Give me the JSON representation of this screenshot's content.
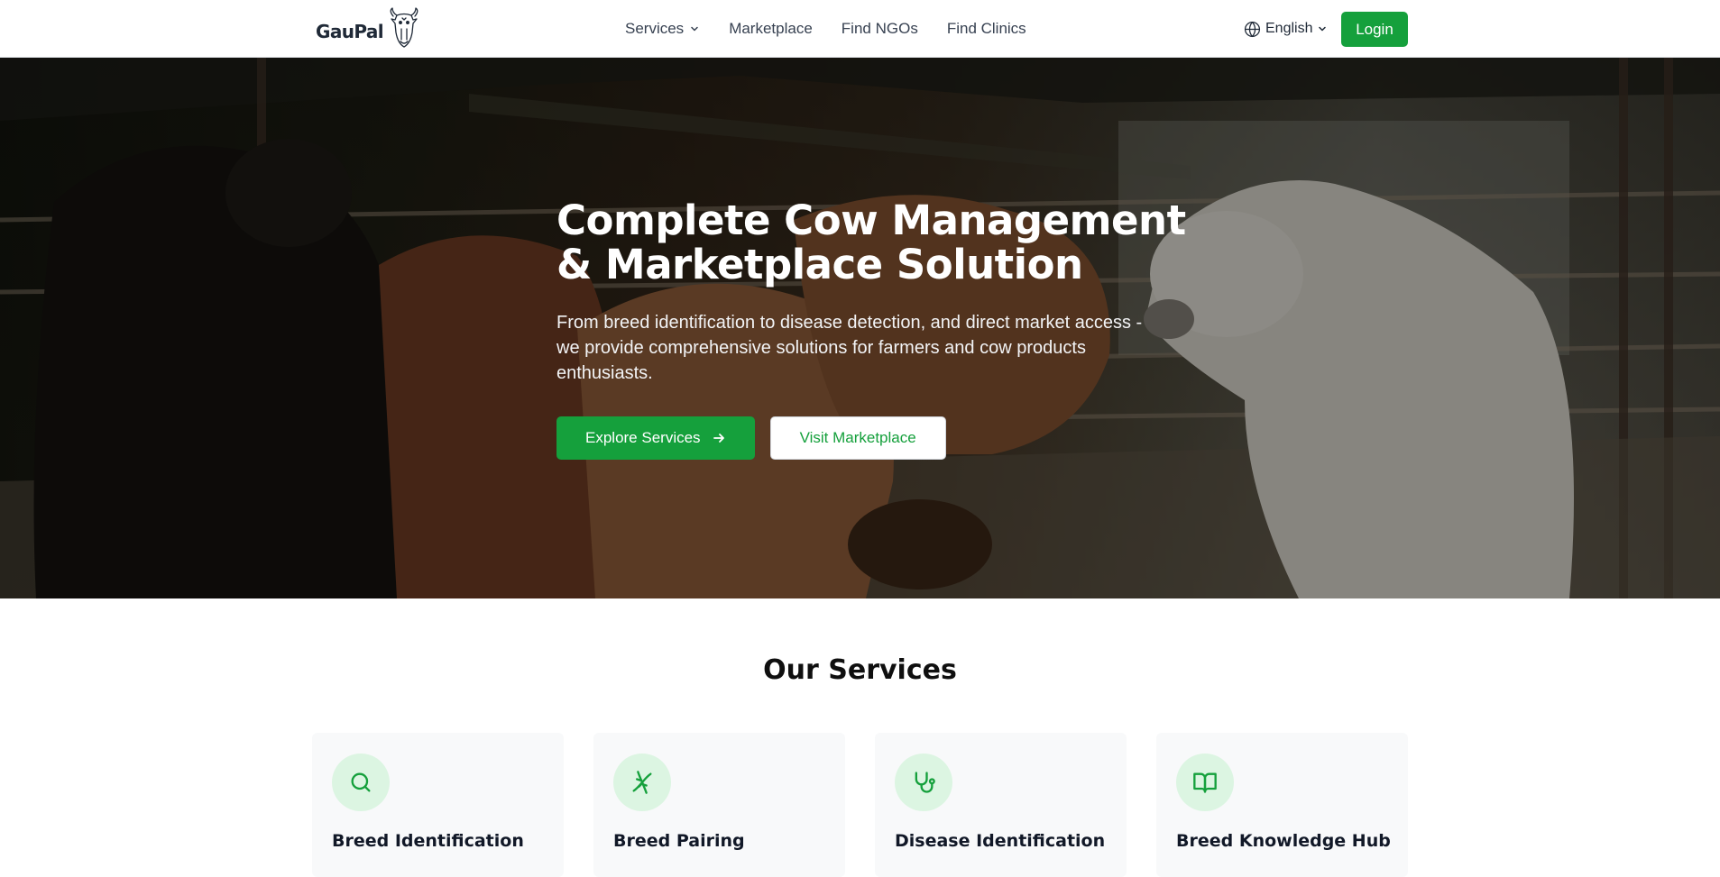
{
  "header": {
    "logo_text": "GauPal",
    "nav": [
      {
        "label": "Services",
        "has_dropdown": true
      },
      {
        "label": "Marketplace"
      },
      {
        "label": "Find NGOs"
      },
      {
        "label": "Find Clinics"
      }
    ],
    "language": "English",
    "login_label": "Login"
  },
  "hero": {
    "title_line1": "Complete Cow Management",
    "title_line2": "& Marketplace Solution",
    "subtitle": "From breed identification to disease detection, and direct market access - we provide comprehensive solutions for farmers and cow products enthusiasts.",
    "primary_cta": "Explore Services",
    "secondary_cta": "Visit Marketplace"
  },
  "services": {
    "heading": "Our Services",
    "cards": [
      {
        "title": "Breed Identification",
        "icon": "search-icon"
      },
      {
        "title": "Breed Pairing",
        "icon": "dna-icon"
      },
      {
        "title": "Disease Identification",
        "icon": "stethoscope-icon"
      },
      {
        "title": "Breed Knowledge Hub",
        "icon": "book-icon"
      }
    ]
  },
  "colors": {
    "brand_green": "#15a03c",
    "icon_circle_bg": "#dcf5e2",
    "card_bg": "#f8f9fa"
  }
}
